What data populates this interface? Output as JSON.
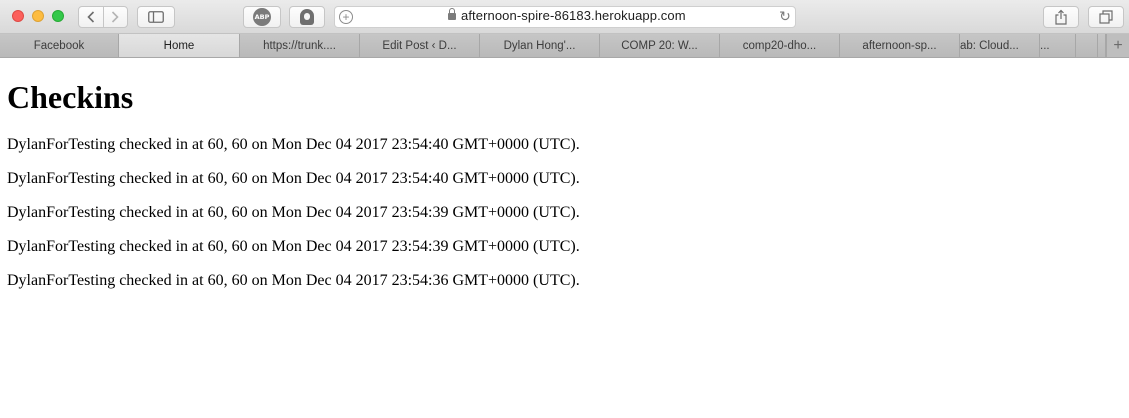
{
  "browser": {
    "url": "afternoon-spire-86183.herokuapp.com",
    "extensions": [
      "ABP"
    ],
    "tabs": [
      {
        "label": "Facebook",
        "active": false
      },
      {
        "label": "Home",
        "active": true
      },
      {
        "label": "https://trunk....",
        "active": false
      },
      {
        "label": "Edit Post ‹ D...",
        "active": false
      },
      {
        "label": "Dylan Hong'...",
        "active": false
      },
      {
        "label": "COMP 20: W...",
        "active": false
      },
      {
        "label": "comp20-dho...",
        "active": false
      },
      {
        "label": "afternoon-sp...",
        "active": false
      },
      {
        "label": "ab: Cloud...",
        "active": false
      },
      {
        "label": "...",
        "active": false
      }
    ]
  },
  "page": {
    "title": "Checkins",
    "checkins": [
      "DylanForTesting checked in at 60, 60 on Mon Dec 04 2017 23:54:40 GMT+0000 (UTC).",
      "DylanForTesting checked in at 60, 60 on Mon Dec 04 2017 23:54:40 GMT+0000 (UTC).",
      "DylanForTesting checked in at 60, 60 on Mon Dec 04 2017 23:54:39 GMT+0000 (UTC).",
      "DylanForTesting checked in at 60, 60 on Mon Dec 04 2017 23:54:39 GMT+0000 (UTC).",
      "DylanForTesting checked in at 60, 60 on Mon Dec 04 2017 23:54:36 GMT+0000 (UTC)."
    ]
  }
}
